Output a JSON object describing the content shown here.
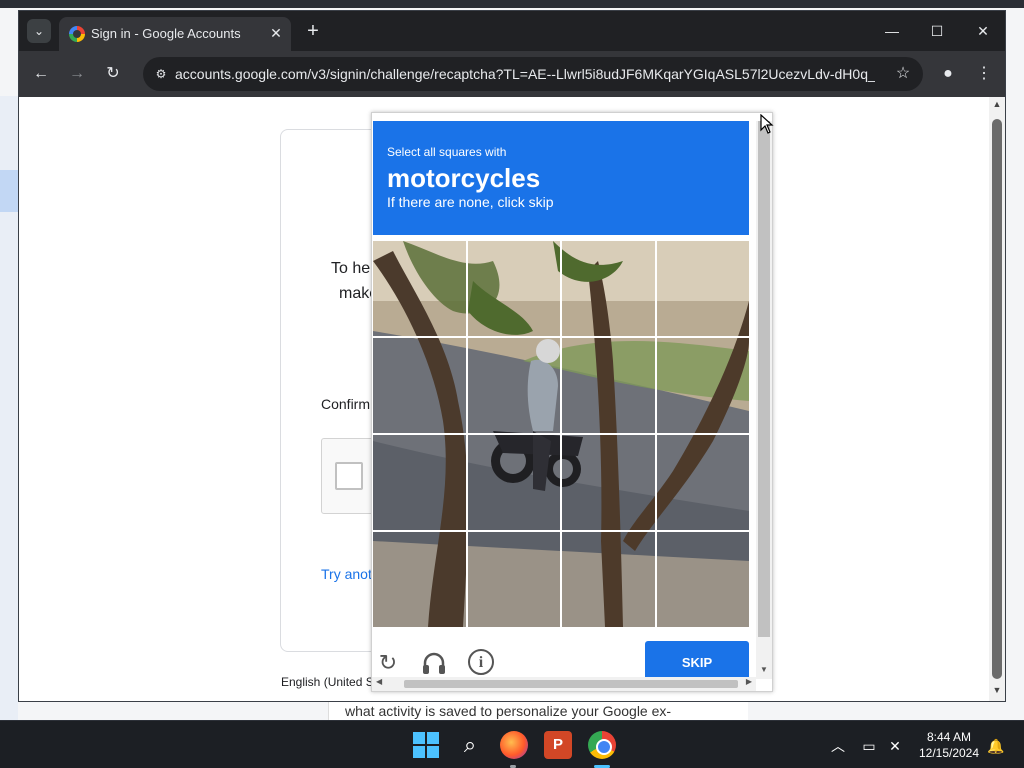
{
  "browser": {
    "tab_title": "Sign in - Google Accounts",
    "tab_close": "✕",
    "new_tab": "+",
    "url": "accounts.google.com/v3/signin/challenge/recaptcha?TL=AE--Llwrl5i8udJF6MKqarYGIqASL57l2UcezvLdv-dH0q_...",
    "icons": [
      "back-icon",
      "forward-icon",
      "reload-icon",
      "site-info-icon",
      "star-icon",
      "profile-icon",
      "menu-icon"
    ]
  },
  "page": {
    "card_text_1": "To hel",
    "card_text_2": "make",
    "confirm_label": "Confirm",
    "try_another": "Try anot",
    "language": "English (United S",
    "behind_text": "what activity is saved to personalize your Google ex-"
  },
  "captcha": {
    "instruction": "Select all squares with",
    "target": "motorcycles",
    "hint": "If there are none, click skip",
    "skip_label": "SKIP",
    "grid_rows": 4,
    "grid_cols": 4,
    "header_color": "#1a73e8",
    "footer_icons": [
      "reload-icon",
      "audio-icon",
      "info-icon"
    ]
  },
  "taskbar": {
    "time": "8:44 AM",
    "date": "12/15/2024",
    "apps": [
      "start-icon",
      "search-icon",
      "firefox-icon",
      "powerpoint-icon",
      "chrome-icon"
    ],
    "ppt_letter": "P"
  }
}
